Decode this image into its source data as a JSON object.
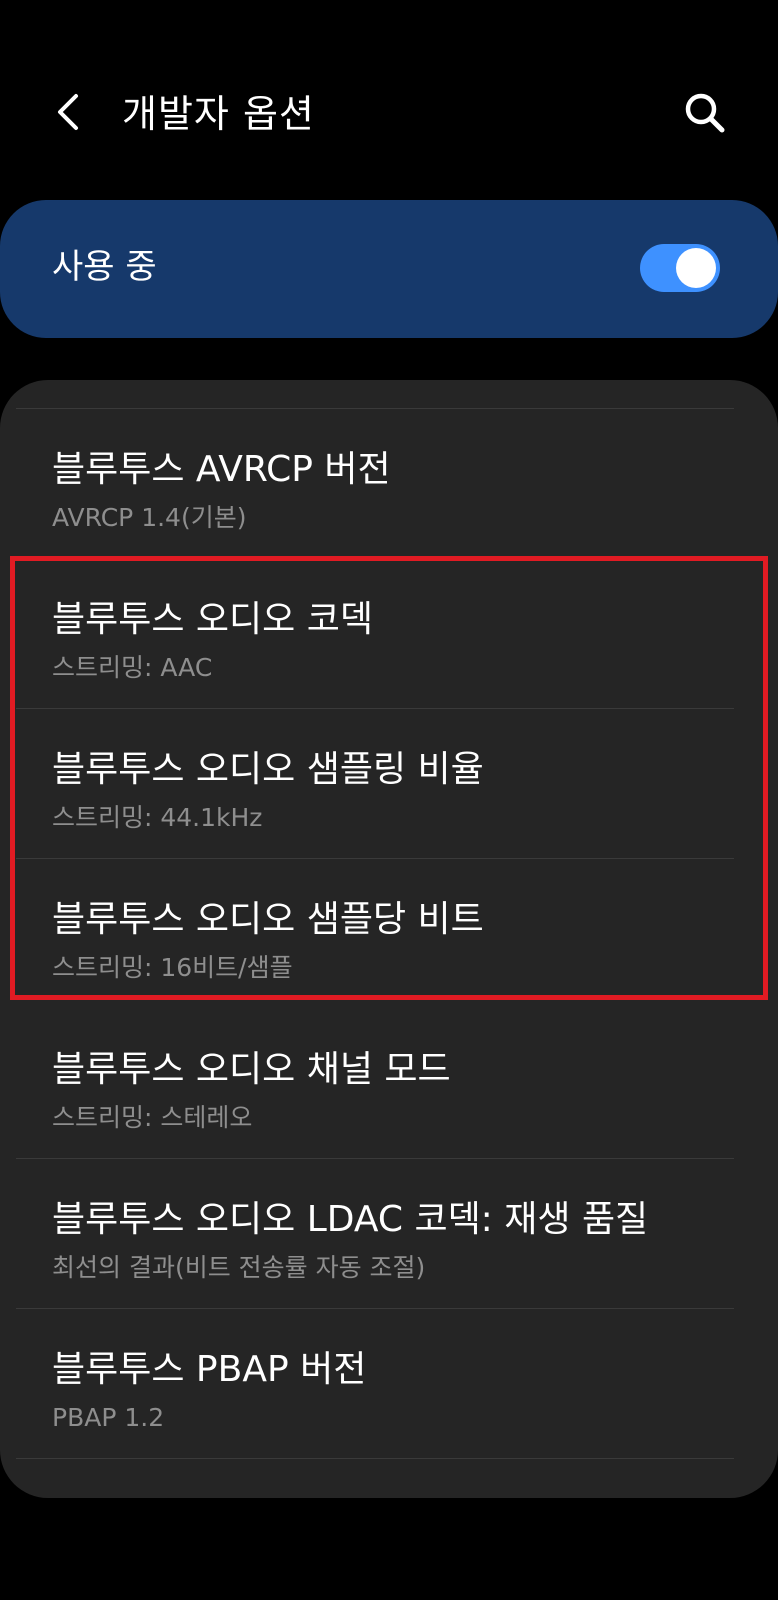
{
  "header": {
    "title": "개발자 옵션",
    "back_icon": "chevron-left-icon",
    "search_icon": "search-icon"
  },
  "master_switch": {
    "label": "사용 중",
    "state": "on",
    "accent_color": "#3e91ff",
    "background_color": "#16396b"
  },
  "settings": [
    {
      "title": "블루투스 AVRCP 버전",
      "summary": "AVRCP 1.4(기본)"
    },
    {
      "title": "블루투스 오디오 코덱",
      "summary": "스트리밍: AAC"
    },
    {
      "title": "블루투스 오디오 샘플링 비율",
      "summary": "스트리밍: 44.1kHz"
    },
    {
      "title": "블루투스 오디오 샘플당 비트",
      "summary": "스트리밍: 16비트/샘플"
    },
    {
      "title": "블루투스 오디오 채널 모드",
      "summary": "스트리밍: 스테레오"
    },
    {
      "title": "블루투스 오디오 LDAC 코덱: 재생 품질",
      "summary": "최선의 결과(비트 전송률 자동 조절)"
    },
    {
      "title": "블루투스 PBAP 버전",
      "summary": "PBAP 1.2"
    }
  ],
  "highlight": {
    "color": "#e11b23"
  }
}
